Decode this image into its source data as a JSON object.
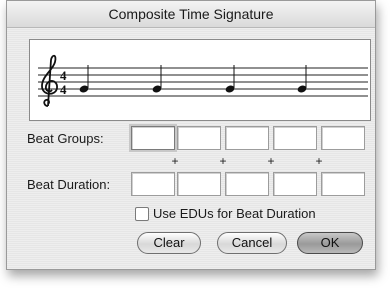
{
  "window": {
    "title": "Composite Time Signature"
  },
  "staff": {
    "clef": "treble-clef-icon",
    "time_signature": {
      "numerator": "4",
      "denominator": "4"
    },
    "notes": 4
  },
  "form": {
    "beat_groups_label": "Beat Groups:",
    "beat_duration_label": "Beat Duration:",
    "plus_sign": "+",
    "beat_groups": [
      "",
      "",
      "",
      "",
      ""
    ],
    "beat_durations": [
      "",
      "",
      "",
      "",
      ""
    ]
  },
  "options": {
    "use_edus_label": "Use EDUs for Beat Duration",
    "use_edus_checked": false
  },
  "buttons": {
    "clear_label": "Clear",
    "cancel_label": "Cancel",
    "ok_label": "OK"
  }
}
